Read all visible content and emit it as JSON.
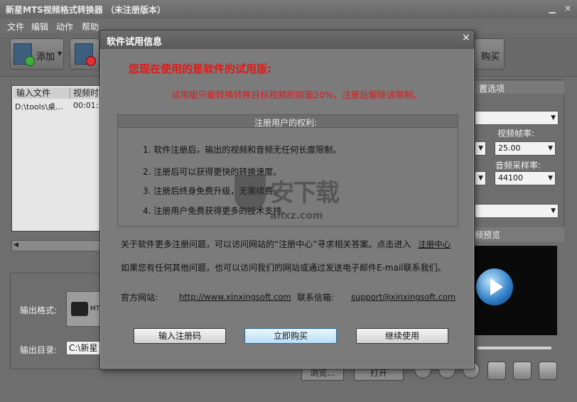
{
  "app": {
    "title": "新星MTS视频格式转换器 （未注册版本）",
    "menu": [
      "文件",
      "编辑",
      "动作",
      "帮助"
    ],
    "toolbar": {
      "add_label": "添加",
      "buy_label": "购买"
    },
    "file_list": {
      "columns": [
        "输入文件",
        "视频时"
      ],
      "rows": [
        {
          "file": "D:\\tools\\桌...",
          "duration": "00:01:3"
        }
      ]
    },
    "output": {
      "format_label": "输出格式:",
      "format_name": "MT",
      "dir_label": "输出目录:",
      "dir_value": "C:\\新星"
    },
    "bottom_buttons": [
      "浏览...",
      "打开"
    ],
    "settings": {
      "header": "置选项",
      "frame_rate_label": "视频帧率:",
      "frame_rate_value": "25.00",
      "sample_rate_label": "音频采样率:",
      "sample_rate_value": "44100"
    },
    "preview": {
      "header": "频预览"
    }
  },
  "dialog": {
    "title": "软件试用信息",
    "close_glyph": "×",
    "heading": "您现在使用的是软件的试用版:",
    "note": "试用版只能转换转换目标视频的前面20%，注册后解除该限制。",
    "rights_title": "注册用户的权利:",
    "rights": [
      "1. 软件注册后，输出的视频和音频无任何长度限制。",
      "2. 注册后可以获得更快的转换速度。",
      "3. 注册后终身免费升级，无需续费。",
      "4. 注册用户免费获得更多的技术支持。"
    ],
    "info_line1_prefix": "关于软件更多注册问题，可以访问网站的“注册中心”寻求相关答案。点击进入",
    "info_line1_link": "注册中心",
    "info_line2": "如果您有任何其他问题，也可以访问我们的网站或通过发送电子邮件E-mail联系我们。",
    "website_label": "官方网站:",
    "website_url": "http://www.xinxingsoft.com",
    "email_label": "联系信箱:",
    "email": "support@xinxingsoft.com",
    "buttons": {
      "register": "输入注册码",
      "buy": "立即购买",
      "continue": "继续使用"
    }
  },
  "watermark": {
    "cn": "安下载",
    "en": "anxz.com"
  }
}
